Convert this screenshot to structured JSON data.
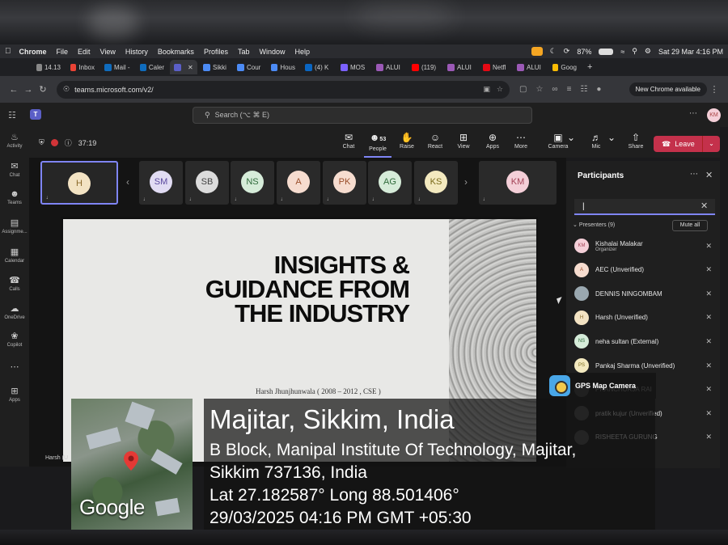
{
  "menubar": {
    "items": [
      "Chrome",
      "File",
      "Edit",
      "View",
      "History",
      "Bookmarks",
      "Profiles",
      "Tab",
      "Window",
      "Help"
    ],
    "battery": "87%",
    "datetime": "Sat 29 Mar  4:16 PM"
  },
  "tabs": [
    {
      "label": "14.13",
      "color": "#888888"
    },
    {
      "label": "Inbox",
      "color": "#ea4335"
    },
    {
      "label": "Mail -",
      "color": "#0f6cbd"
    },
    {
      "label": "Caler",
      "color": "#0f6cbd"
    },
    {
      "label": "",
      "color": "#5b5fc7",
      "active": true
    },
    {
      "label": "Sikki",
      "color": "#4c8bf5"
    },
    {
      "label": "Cour",
      "color": "#4c8bf5"
    },
    {
      "label": "Hous",
      "color": "#4c8bf5"
    },
    {
      "label": "(4) K",
      "color": "#0a66c2"
    },
    {
      "label": "MOS",
      "color": "#7b61ff"
    },
    {
      "label": "ALUI",
      "color": "#9b59b6"
    },
    {
      "label": "(119)",
      "color": "#ff0000"
    },
    {
      "label": "ALUI",
      "color": "#9b59b6"
    },
    {
      "label": "Netfl",
      "color": "#e50914"
    },
    {
      "label": "ALUI",
      "color": "#9b59b6"
    },
    {
      "label": "Goog",
      "color": "#fbbc04"
    }
  ],
  "address": {
    "url": "teams.microsoft.com/v2/",
    "new_chrome": "New Chrome available"
  },
  "teams": {
    "search_placeholder": "Search (⌥ ⌘ E)",
    "user_initials": "KM",
    "rail": [
      "Activity",
      "Chat",
      "Teams",
      "Assignme...",
      "Calendar",
      "Calls",
      "OneDrive",
      "Copilot",
      "",
      "Apps"
    ],
    "timer": "37:19",
    "controls": {
      "chat": "Chat",
      "people": "People",
      "people_count": "53",
      "raise": "Raise",
      "react": "React",
      "view": "View",
      "apps": "Apps",
      "more": "More",
      "camera": "Camera",
      "mic": "Mic",
      "share": "Share",
      "leave": "Leave"
    }
  },
  "strip": [
    {
      "initials": "H",
      "bg": "#f3e3c3",
      "fg": "#8a6a2a"
    },
    {
      "initials": "SM",
      "bg": "#e1dcf3",
      "fg": "#5b4a9e"
    },
    {
      "initials": "SB",
      "bg": "#dcdcdc",
      "fg": "#444444"
    },
    {
      "initials": "NS",
      "bg": "#d6ecd9",
      "fg": "#2f6b3b"
    },
    {
      "initials": "A",
      "bg": "#f6dccf",
      "fg": "#9a4e2a"
    },
    {
      "initials": "PK",
      "bg": "#f6dccf",
      "fg": "#9a4e2a"
    },
    {
      "initials": "AG",
      "bg": "#d6ecd9",
      "fg": "#2f6b3b"
    },
    {
      "initials": "KS",
      "bg": "#f3e9bf",
      "fg": "#7a6a1a"
    },
    {
      "initials": "KM",
      "bg": "#f4cfd8",
      "fg": "#a44458"
    }
  ],
  "slide": {
    "title_line1": "INSIGHTS &",
    "title_line2": "GUIDANCE FROM",
    "title_line3": "THE INDUSTRY",
    "subtitle": "Harsh Jhunjhunwala ( 2008 – 2012 , CSE )",
    "name_chip": "Harsh (U"
  },
  "panel": {
    "title": "Participants",
    "search_value": "|",
    "presenters_label": "Presenters (9)",
    "mute_all": "Mute all",
    "rows": [
      {
        "name": "Kishalai Malakar",
        "role": "Organizer",
        "initials": "KM",
        "bg": "#f4cfd8",
        "fg": "#a44458"
      },
      {
        "name": "AEC (Unverified)",
        "role": "",
        "initials": "A",
        "bg": "#f6dccf",
        "fg": "#9a4e2a"
      },
      {
        "name": "DENNIS NINGOMBAM",
        "role": "",
        "initials": "",
        "bg": "#9aa8b0",
        "fg": "#333333"
      },
      {
        "name": "Harsh (Unverified)",
        "role": "",
        "initials": "H",
        "bg": "#f3e3c3",
        "fg": "#8a6a2a"
      },
      {
        "name": "neha sultan (External)",
        "role": "",
        "initials": "NS",
        "bg": "#d6ecd9",
        "fg": "#2f6b3b"
      },
      {
        "name": "Pankaj Sharma (Unverified)",
        "role": "",
        "initials": "PS",
        "bg": "#f3e9bf",
        "fg": "#7a6a1a"
      },
      {
        "name": "PRANCHURJA RAI",
        "role": "",
        "initials": "",
        "bg": "#666666",
        "fg": "#cccccc"
      },
      {
        "name": "pratik kujur (Unverified)",
        "role": "",
        "initials": "",
        "bg": "#555555",
        "fg": "#cccccc"
      },
      {
        "name": "RISHEETA GURUNG",
        "role": "",
        "initials": "",
        "bg": "#555555",
        "fg": "#cccccc"
      }
    ]
  },
  "gps": {
    "badge": "GPS Map Camera",
    "place": "Majitar, Sikkim, India",
    "address_line1": "B Block, Manipal Institute Of Technology, Majitar,",
    "address_line2": "Sikkim 737136, India",
    "coords": "Lat 27.182587° Long 88.501406°",
    "datetime": "29/03/2025 04:16 PM GMT +05:30",
    "map_brand": "Google"
  }
}
